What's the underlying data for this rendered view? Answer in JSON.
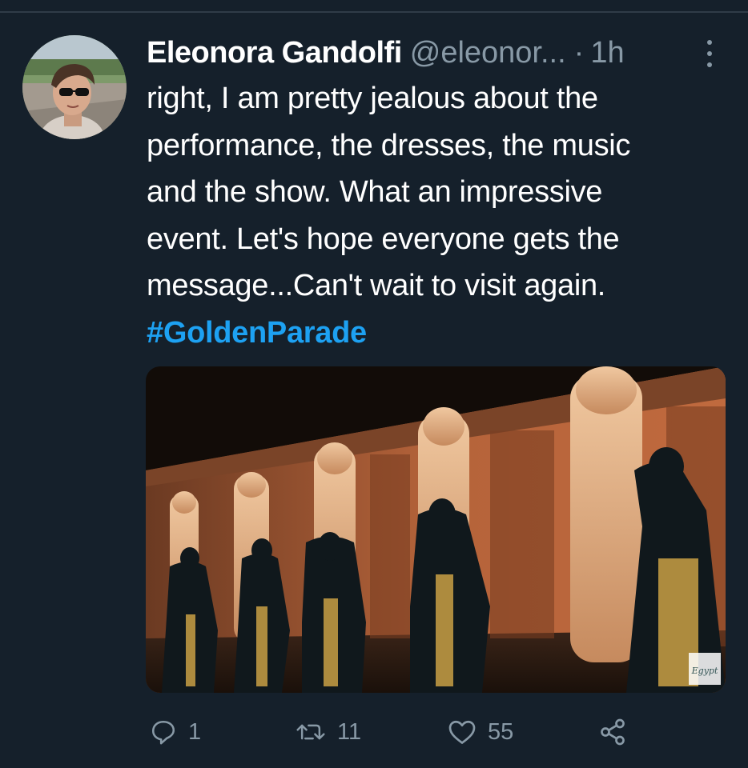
{
  "tweet": {
    "author": {
      "display_name": "Eleonora Gandolfi",
      "handle": "@eleonor...",
      "avatar": "profile-photo"
    },
    "separator": "·",
    "timestamp": "1h",
    "text_lines": [
      "right, I am pretty jealous about the",
      "performance, the dresses, the music",
      "and the show. What an impressive",
      "event. Let's hope everyone gets the",
      "message...Can't wait to visit again."
    ],
    "hashtag": "#GoldenParade",
    "media": {
      "description_icon": "temple-performance-photo",
      "watermark_text": "Egypt"
    },
    "actions": {
      "replies": "1",
      "retweets": "11",
      "likes": "55"
    },
    "icons": {
      "more": "more-vertical-icon",
      "reply": "reply-icon",
      "retweet": "retweet-icon",
      "like": "heart-icon",
      "share": "share-icon"
    }
  },
  "colors": {
    "background": "#15202b",
    "primary_text": "#ffffff",
    "secondary_text": "#8899a6",
    "accent": "#1da1f2"
  }
}
